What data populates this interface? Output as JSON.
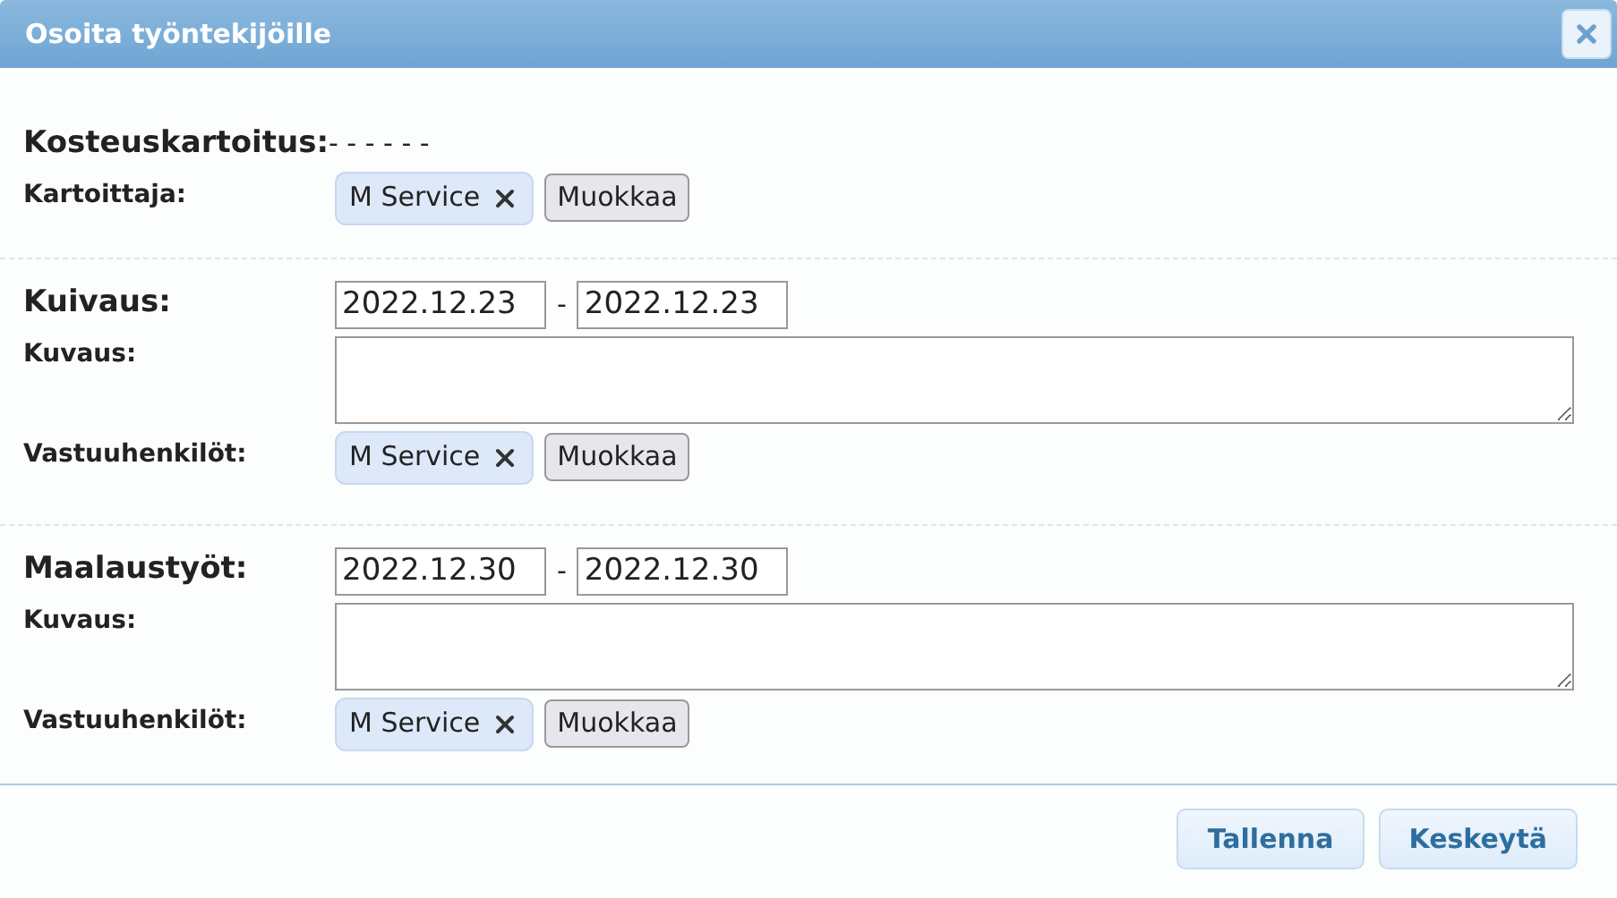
{
  "window": {
    "title": "Osoita työntekijöille"
  },
  "sections": [
    {
      "kind": "survey",
      "heading": "Kosteuskartoitus:",
      "heading_note": "- - - - - -",
      "assignees": {
        "label": "Kartoittaja:",
        "people": [
          {
            "name": "M Service"
          }
        ],
        "edit_button": "Muokkaa"
      }
    },
    {
      "kind": "task",
      "heading": "Kuivaus:",
      "date_from": "2022.12.23",
      "date_separator": "-",
      "date_to": "2022.12.23",
      "description": {
        "label": "Kuvaus:"
      },
      "assignees": {
        "label": "Vastuuhenkilöt:",
        "people": [
          {
            "name": "M Service"
          }
        ],
        "edit_button": "Muokkaa"
      }
    },
    {
      "kind": "task",
      "heading": "Maalaustyöt:",
      "date_from": "2022.12.30",
      "date_separator": "-",
      "date_to": "2022.12.30",
      "description": {
        "label": "Kuvaus:"
      },
      "assignees": {
        "label": "Vastuuhenkilöt:",
        "people": [
          {
            "name": "M Service"
          }
        ],
        "edit_button": "Muokkaa"
      }
    }
  ],
  "buttons": [
    "Tallenna",
    "Keskeytä"
  ]
}
